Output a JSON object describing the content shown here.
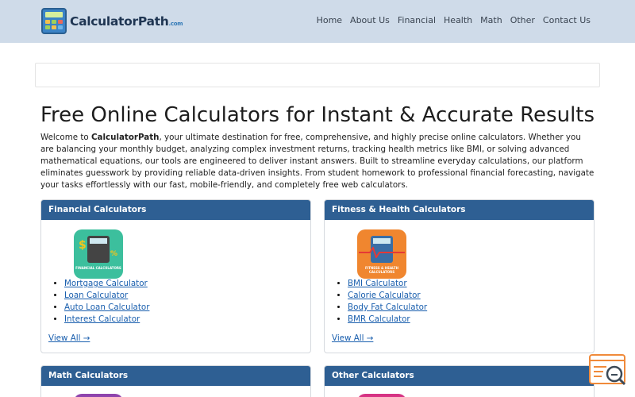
{
  "header": {
    "brand": "CalculatorPath",
    "brand_suffix": ".com",
    "nav": [
      "Home",
      "About Us",
      "Financial",
      "Health",
      "Math",
      "Other",
      "Contact Us"
    ]
  },
  "hero": {
    "title": "Free Online Calculators for Instant & Accurate Results",
    "intro_brand": "CalculatorPath",
    "intro_before": "Welcome to ",
    "intro_after": ", your ultimate destination for free, comprehensive, and highly precise online calculators. Whether you are balancing your monthly budget, analyzing complex investment returns, tracking health metrics like BMI, or solving advanced mathematical equations, our tools are engineered to deliver instant answers. Built to streamline everyday calculations, our platform eliminates guesswork by providing reliable data-driven insights. From student homework to professional financial forecasting, navigate your tasks effortlessly with our fast, mobile-friendly, and completely free web calculators."
  },
  "cards": [
    {
      "title": "Financial Calculators",
      "icon_caption": "FINANCIAL CALCULATORS",
      "icon_color": "#3cbf9d",
      "links": [
        "Mortgage Calculator",
        "Loan Calculator",
        "Auto Loan Calculator",
        "Interest Calculator"
      ],
      "view_all": "View All →"
    },
    {
      "title": "Fitness & Health Calculators",
      "icon_caption": "FITNESS & HEALTH CALCULATORS",
      "icon_color": "#f0862f",
      "links": [
        "BMI Calculator",
        "Calorie Calculator",
        "Body Fat Calculator",
        "BMR Calculator"
      ],
      "view_all": "View All →"
    },
    {
      "title": "Math Calculators"
    },
    {
      "title": "Other Calculators"
    }
  ],
  "colors": {
    "header_bg": "#cfdbe9",
    "card_head": "#2e5f93",
    "link": "#1a5fae"
  }
}
